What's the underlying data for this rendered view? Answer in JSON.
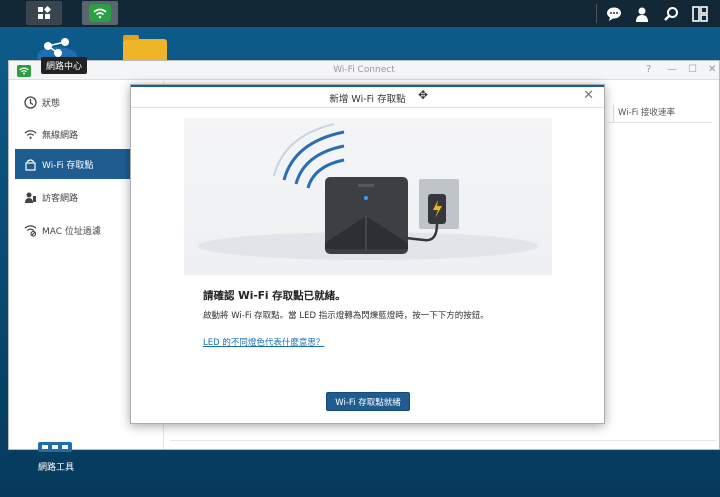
{
  "taskbar": {
    "main_menu_icon": "grid-icon",
    "active_app_icon": "wifi-icon",
    "right_icons": [
      "chat-icon",
      "user-icon",
      "search-icon",
      "widgets-icon"
    ]
  },
  "desktop": {
    "network_center_label": "網路中心",
    "network_tools_label": "網路工具"
  },
  "window": {
    "title": "Wi-Fi Connect",
    "controls": [
      "?",
      "—",
      "☐",
      "✕"
    ],
    "sidebar": [
      {
        "label": "狀態",
        "icon": "status-icon"
      },
      {
        "label": "無線網路",
        "icon": "wifi-icon"
      },
      {
        "label": "Wi-Fi 存取點",
        "icon": "access-point-icon"
      },
      {
        "label": "訪客網路",
        "icon": "guest-icon"
      },
      {
        "label": "MAC 位址過濾",
        "icon": "mac-filter-icon"
      }
    ],
    "column_header": "Wi-Fi 接收速率"
  },
  "dialog": {
    "title": "新增 Wi-Fi 存取點",
    "heading": "請確認 Wi-Fi 存取點已就緒。",
    "body": "啟動將 Wi-Fi 存取點。當 LED 指示燈轉為閃爍藍燈時，按一下下方的按鈕。",
    "link": "LED 的不同燈色代表什麼意思？",
    "button": "Wi-Fi 存取點就緒"
  },
  "colors": {
    "accent": "#1f5d91",
    "wifi_green": "#2aa043",
    "link": "#1a6fb0"
  }
}
